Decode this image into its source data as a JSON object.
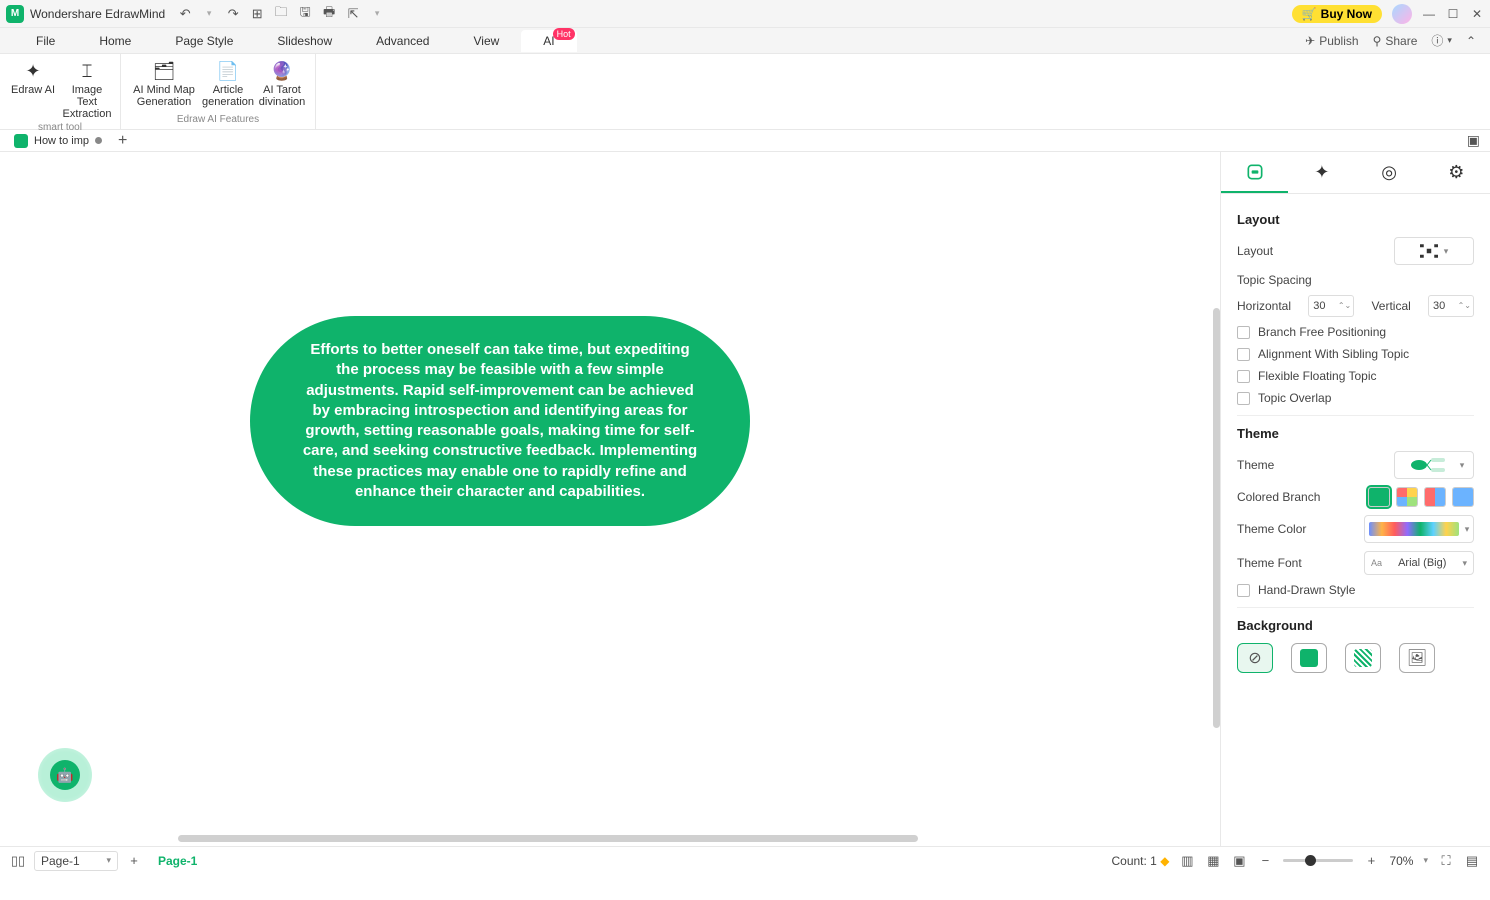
{
  "titlebar": {
    "app_name": "Wondershare EdrawMind",
    "buy_now": "Buy Now"
  },
  "menu": {
    "items": [
      "File",
      "Home",
      "Page Style",
      "Slideshow",
      "Advanced",
      "View",
      "AI"
    ],
    "hot": "Hot",
    "publish": "Publish",
    "share": "Share"
  },
  "ribbon": {
    "smart_tool": {
      "label": "smart tool",
      "items": [
        {
          "label": "Edraw AI"
        },
        {
          "label": "Image Text Extraction"
        }
      ]
    },
    "ai_features": {
      "label": "Edraw AI Features",
      "items": [
        {
          "label": "AI Mind Map Generation"
        },
        {
          "label": "Article generation"
        },
        {
          "label": "AI Tarot divination"
        }
      ]
    }
  },
  "doc_tab": {
    "name": "How to imp"
  },
  "canvas": {
    "topic_text": "Efforts to better oneself can take time, but expediting the process may be feasible with a few simple adjustments. Rapid self-improvement can be achieved by embracing introspection and identifying areas for growth, setting reasonable goals, making time for self-care, and seeking constructive feedback. Implementing these practices may enable one to rapidly refine and enhance their character and capabilities."
  },
  "panel": {
    "layout_title": "Layout",
    "layout_label": "Layout",
    "topic_spacing": "Topic Spacing",
    "horizontal": "Horizontal",
    "horizontal_val": "30",
    "vertical": "Vertical",
    "vertical_val": "30",
    "branch_free": "Branch Free Positioning",
    "align_sibling": "Alignment With Sibling Topic",
    "flex_floating": "Flexible Floating Topic",
    "topic_overlap": "Topic Overlap",
    "theme_title": "Theme",
    "theme_label": "Theme",
    "colored_branch": "Colored Branch",
    "theme_color": "Theme Color",
    "theme_font": "Theme Font",
    "theme_font_val": "Arial (Big)",
    "hand_drawn": "Hand-Drawn Style",
    "background_title": "Background"
  },
  "status": {
    "page_sel": "Page-1",
    "page_tab": "Page-1",
    "count_label": "Count: 1",
    "zoom": "70%"
  }
}
